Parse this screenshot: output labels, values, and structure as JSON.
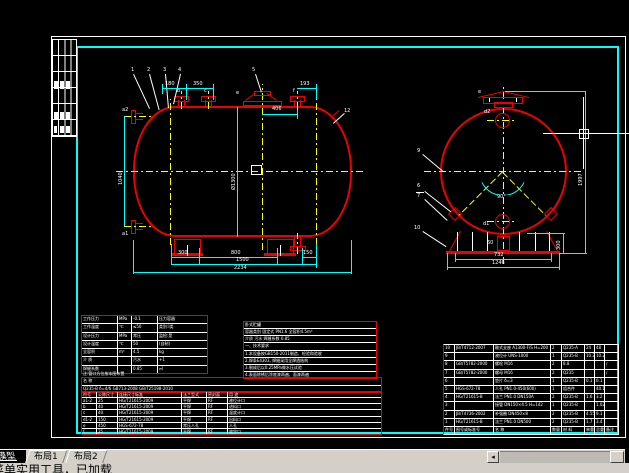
{
  "ui": {
    "tabs": [
      {
        "label": "模型"
      },
      {
        "label": "布局1"
      },
      {
        "label": "布局2"
      }
    ],
    "scroll_left_arrow": "◂",
    "status": "菜单实用工具，已加载"
  },
  "sv": {
    "n1": "1",
    "n2": "2",
    "n3": "3",
    "n4": "4",
    "n5": "5",
    "n12": "12",
    "la2": "a2",
    "la1": "a1",
    "lb": "b",
    "lc": "c",
    "le": "e",
    "lf": "f",
    "d180": "180",
    "d350": "350",
    "d406": "406",
    "d193": "193",
    "d1040": "1040",
    "d1300": "Ø1300",
    "d300": "300",
    "d800": "800",
    "d150": "150",
    "d1500": "1500",
    "d2234": "2234"
  },
  "ev": {
    "n9": "9",
    "n6": "6",
    "n7": "7",
    "n10": "10",
    "ld2": "d2",
    "ld1": "d1",
    "le": "e",
    "ang": "90°",
    "n60": "60",
    "d1997": "1997",
    "d300": "300",
    "d732": "732",
    "d1246": "1246"
  },
  "tables": {
    "note": "注:管口方位按本图布置",
    "char": {
      "rows": [
        [
          "工作压力",
          "MPa",
          "-0.1",
          "压力容器"
        ],
        [
          "工作温度",
          "℃",
          "≤50",
          "类别:Ⅰ类"
        ],
        [
          "设计压力",
          "MPa",
          "常压",
          "监检:是"
        ],
        [
          "设计温度",
          "℃",
          "50",
          "(自制)"
        ],
        [
          "全容积",
          "m³",
          "4.5",
          "kg"
        ],
        [
          "介  质",
          "",
          "污水",
          "+1"
        ],
        [
          "焊缝系数",
          "",
          "0.85",
          "㎡"
        ]
      ]
    },
    "namebox": {
      "rows": [
        [
          "名  称"
        ],
        [
          "Q235-B δ=4/6  GB713-2008  GB/T25198-2010"
        ]
      ]
    },
    "nozzle": {
      "rows": [
        [
          "符号",
          "公称尺寸",
          "连接尺寸标准",
          "法兰型式",
          "密封面",
          "用  途"
        ],
        [
          "a1-2",
          "25",
          "HG/T21615-2009",
          "平焊",
          "RF",
          "液位计口"
        ],
        [
          "b",
          "40",
          "HG/T21615-2009",
          "平焊",
          "RF",
          "进料口"
        ],
        [
          "c",
          "40",
          "HG/T21615-2009",
          "平焊",
          "RF",
          "温度计口"
        ],
        [
          "d1-2",
          "150",
          "HG/T21615-2009",
          "平焊",
          "RF",
          "出料口"
        ],
        [
          "e",
          "450",
          "HGS-672-78",
          "常压人孔",
          "",
          "人孔"
        ],
        [
          "f",
          "25",
          "HG/T21615-2009",
          "平焊",
          "RF",
          "放空口"
        ]
      ]
    },
    "middle": {
      "rows": [
        [
          "卧式贮罐"
        ],
        [
          "容器类别 固定式  PN1.6  全容积4.5m³"
        ],
        [
          "介质 污水   焊缝系数 0.85"
        ],
        [
          "一、技术要求"
        ],
        [
          "1.本设备按GB150-2011制造、检验和验收"
        ],
        [
          "2.焊条E4303, 焊缝采用全焊透结构"
        ],
        [
          "3.制成后以0.25MPa做水压试验"
        ],
        [
          "4.表面除锈后涂底漆两遍、面漆两遍"
        ]
      ]
    },
    "parts": {
      "rows": [
        [
          "10",
          "JB/T4712-2007",
          "鞍式支座 A1300-F/S H=200",
          "2",
          "Q235-A",
          "24",
          "48",
          ""
        ],
        [
          "9",
          "",
          "液位计 UNS-1000",
          "1",
          "Q235-B",
          "10.2",
          "10.2",
          ""
        ],
        [
          "8",
          "GB/T5782-2000",
          "螺栓 M16",
          "2",
          "8.8",
          "",
          "",
          "∕"
        ],
        [
          "7",
          "GB/T5782-2000",
          "螺母 M16",
          "2",
          "Q235",
          "",
          "",
          "∕"
        ],
        [
          "6",
          "",
          "垫片 δ=3",
          "1",
          "Q235-B",
          "0.1",
          "0.1",
          ""
        ],
        [
          "5",
          "HGS-672-78",
          "人孔 PN1.0-450(600)",
          "1",
          "组合件",
          "",
          "40.1",
          ""
        ],
        [
          "4",
          "HG/T21615-B",
          "法兰 PN1.0 DN150A",
          "2",
          "Q235-B",
          "1.6",
          "3.2",
          ""
        ],
        [
          "3",
          "",
          "接管 DN150×4.5 H=142",
          "1",
          "Q235-B",
          "",
          "1.02",
          ""
        ],
        [
          "2",
          "JB/T4736-2002",
          "补强圈 DN450×8",
          "2",
          "Q235-B",
          "4.55",
          "9.1",
          ""
        ],
        [
          "1",
          "HG/T21615-B",
          "法兰 PN1.0 DN500",
          "2",
          "Q235-B",
          "1.7",
          "3.4",
          ""
        ],
        [
          "件号",
          "图号或标准号",
          "名    称",
          "数量",
          "材  料",
          "单重",
          "总重",
          "备注"
        ]
      ]
    }
  }
}
